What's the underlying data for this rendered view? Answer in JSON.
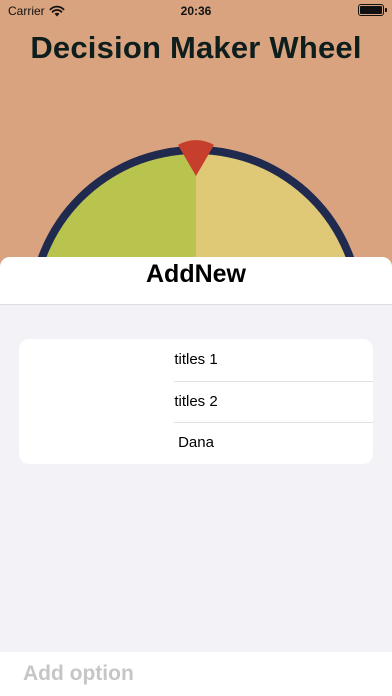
{
  "status_bar": {
    "carrier": "Carrier",
    "time": "20:36"
  },
  "page": {
    "title": "Decision Maker Wheel"
  },
  "wheel": {
    "segments": [
      {
        "color": "#b9c44f"
      },
      {
        "color": "#dfc977"
      }
    ],
    "rim_color": "#1f2a4e",
    "pointer_color": "#c63f2d"
  },
  "sheet": {
    "title": "AddNew",
    "options": [
      {
        "label": "titles 1"
      },
      {
        "label": "titles 2"
      },
      {
        "label": "Dana"
      }
    ],
    "add_option_placeholder": "Add option"
  },
  "colors": {
    "background": "#d8a37e",
    "title_text": "#0e1e1d",
    "sheet_background": "#f2f2f7"
  }
}
